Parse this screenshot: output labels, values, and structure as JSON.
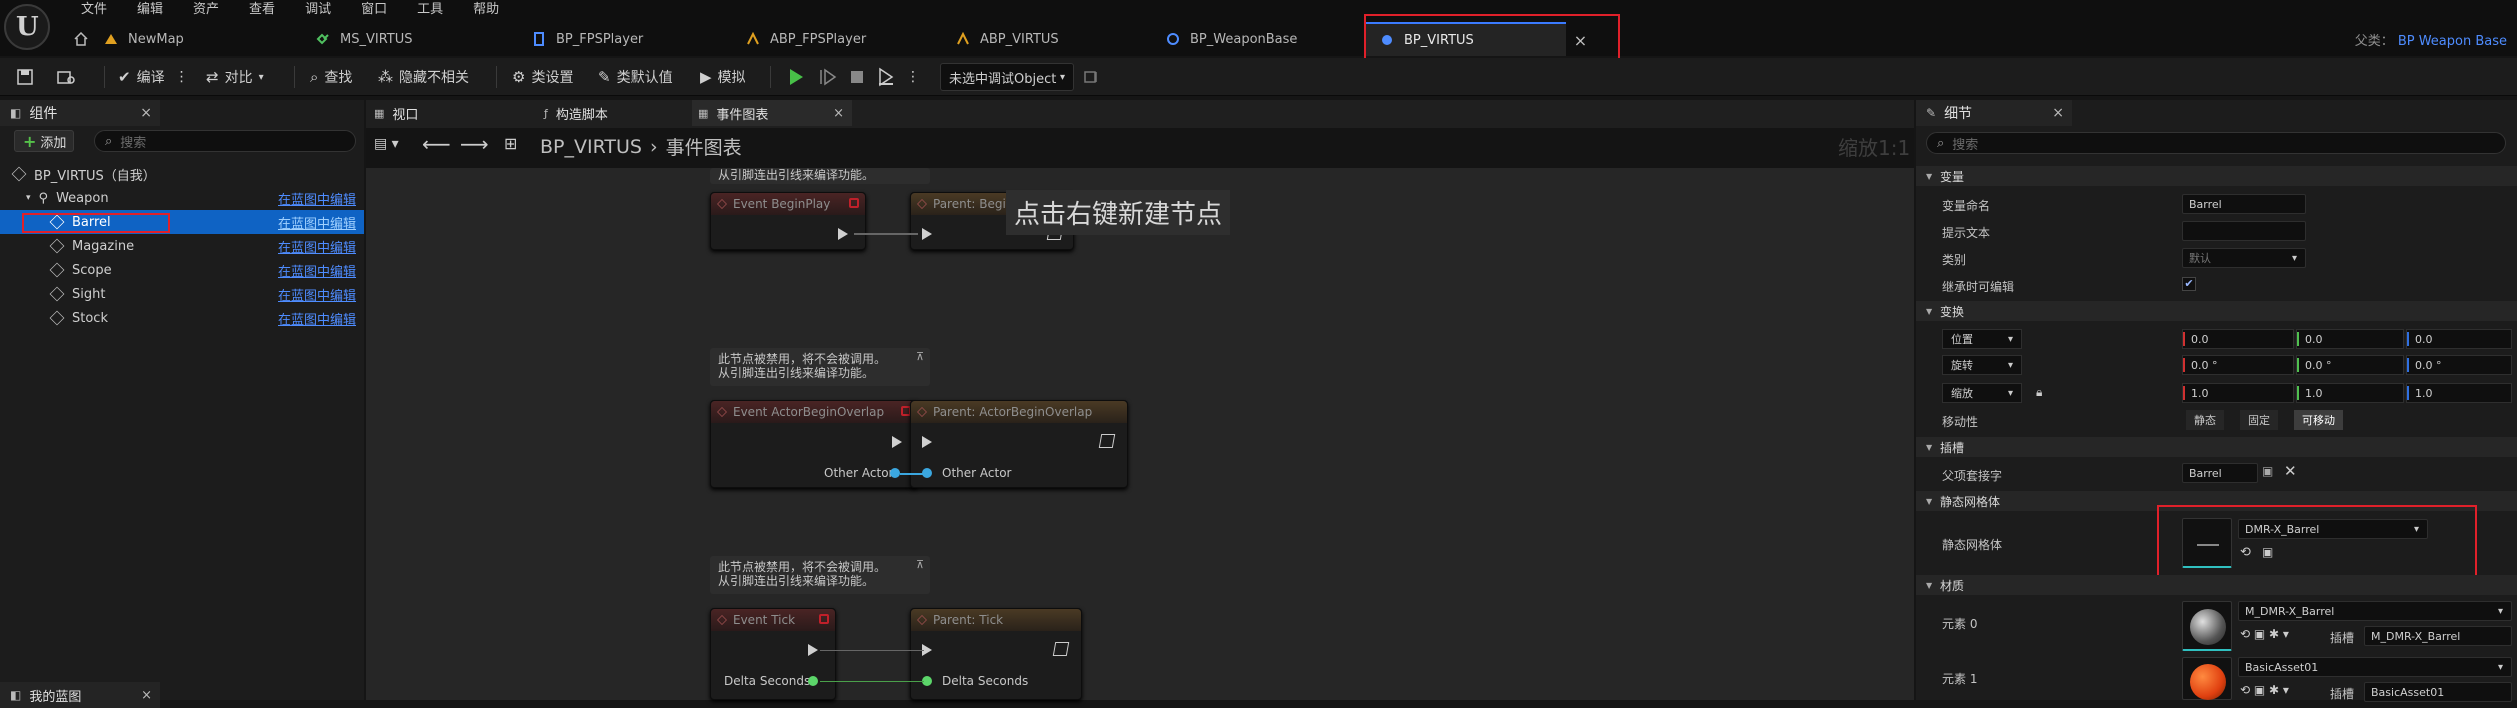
{
  "menu": [
    "文件",
    "编辑",
    "资产",
    "查看",
    "调试",
    "窗口",
    "工具",
    "帮助"
  ],
  "tabs": [
    {
      "label": "NewMap"
    },
    {
      "label": "MS_VIRTUS"
    },
    {
      "label": "BP_FPSPlayer"
    },
    {
      "label": "ABP_FPSPlayer"
    },
    {
      "label": "ABP_VIRTUS"
    },
    {
      "label": "BP_WeaponBase"
    },
    {
      "label": "BP_VIRTUS",
      "active": true
    }
  ],
  "parent_class": {
    "label": "父类：",
    "value": "BP Weapon Base"
  },
  "toolbar": {
    "compile": "编译",
    "diff": "对比",
    "find": "查找",
    "hide_unrelated": "隐藏不相关",
    "class_settings": "类设置",
    "class_defaults": "类默认值",
    "simulate": "模拟",
    "debug_object": "未选中调试Object"
  },
  "components": {
    "panel_title": "组件",
    "add": "添加",
    "search_placeholder": "搜索",
    "root": "BP_VIRTUS（自我）",
    "edit_label": "在蓝图中编辑",
    "items": [
      {
        "label": "Weapon",
        "edit": "在蓝图中编辑"
      },
      {
        "label": "Barrel",
        "edit": "在蓝图中编辑",
        "selected": true
      },
      {
        "label": "Magazine",
        "edit": "在蓝图中编辑"
      },
      {
        "label": "Scope",
        "edit": "在蓝图中编辑"
      },
      {
        "label": "Sight",
        "edit": "在蓝图中编辑"
      },
      {
        "label": "Stock",
        "edit": "在蓝图中编辑"
      }
    ],
    "my_blueprint": "我的蓝图"
  },
  "center": {
    "tabs": [
      "视口",
      "构造脚本",
      "事件图表"
    ],
    "breadcrumb_root": "BP_VIRTUS",
    "breadcrumb_sep": "›",
    "breadcrumb_leaf": "事件图表",
    "zoom": "缩放1:1",
    "hint": "点击右键新建节点",
    "disabled_note_1": "此节点被禁用，将不会被调用。",
    "disabled_note_2": "从引脚连出引线来编译功能。",
    "nodes": {
      "begin_play": "Event BeginPlay",
      "parent_begin": "Parent: BeginPlay",
      "overlap": "Event ActorBeginOverlap",
      "parent_overlap": "Parent: ActorBeginOverlap",
      "other_actor": "Other Actor",
      "tick": "Event Tick",
      "parent_tick": "Parent: Tick",
      "delta_seconds": "Delta Seconds"
    }
  },
  "details": {
    "panel_title": "细节",
    "search_placeholder": "搜索",
    "sections": {
      "variables": "变量",
      "transform": "变换",
      "sockets": "插槽",
      "static_mesh": "静态网格体",
      "materials": "材质"
    },
    "var_name_label": "变量命名",
    "var_name_value": "Barrel",
    "tooltip_label": "提示文本",
    "category_label": "类别",
    "category_value": "默认",
    "inherit_label": "继承时可编辑",
    "location": "位置",
    "rotation": "旋转",
    "scale": "缩放",
    "loc": [
      "0.0",
      "0.0",
      "0.0"
    ],
    "rot": [
      "0.0 °",
      "0.0 °",
      "0.0 °"
    ],
    "scl": [
      "1.0",
      "1.0",
      "1.0"
    ],
    "mobility_label": "移动性",
    "mobility": [
      "静态",
      "固定",
      "可移动"
    ],
    "parent_socket_label": "父项套接字",
    "parent_socket_value": "Barrel",
    "static_mesh_label": "静态网格体",
    "static_mesh_value": "DMR-X_Barrel",
    "element0_label": "元素 0",
    "element0_value": "M_DMR-X_Barrel",
    "element1_label": "元素 1",
    "element1_value": "BasicAsset01",
    "slot_label": "插槽",
    "slot0": "M_DMR-X_Barrel",
    "slot1": "BasicAsset01"
  }
}
